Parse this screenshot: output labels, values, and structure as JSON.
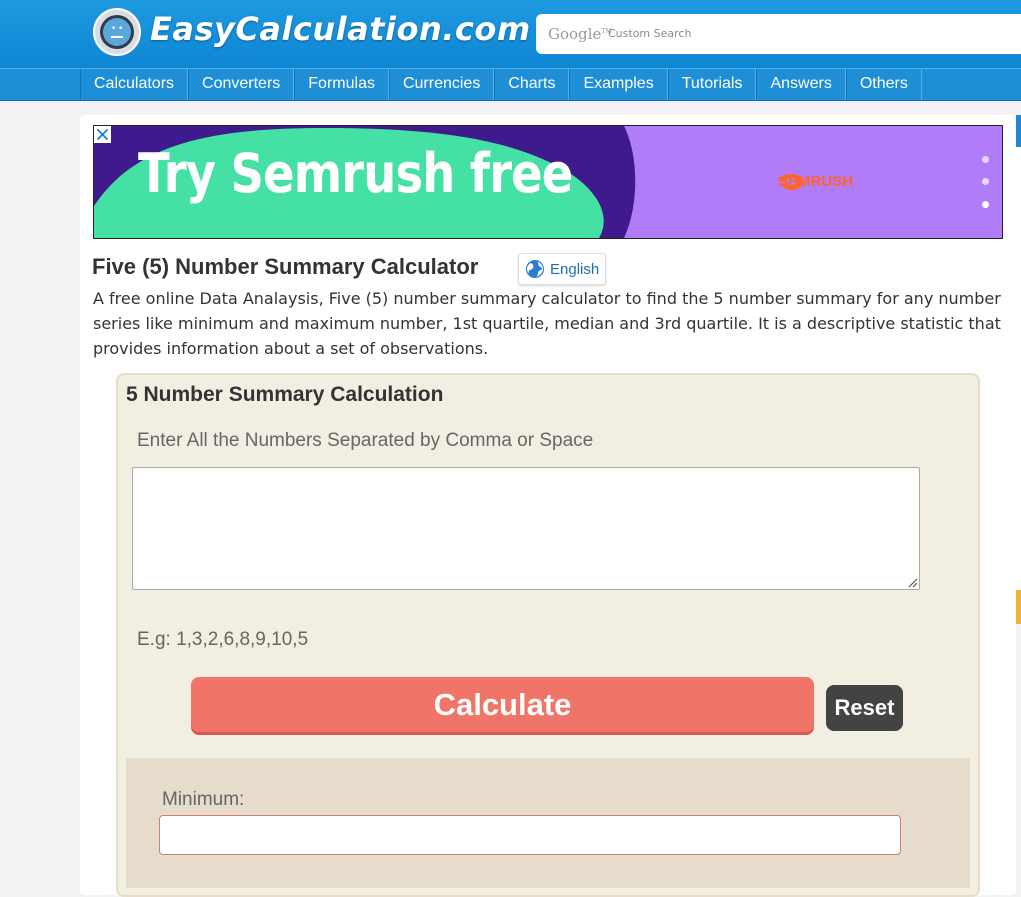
{
  "site": {
    "logo_text": "EasyCalculation.com",
    "search_brand": "Google",
    "search_brand_tm": "TM",
    "search_placeholder": "Custom Search"
  },
  "nav": {
    "items": [
      "Calculators",
      "Converters",
      "Formulas",
      "Currencies",
      "Charts",
      "Examples",
      "Tutorials",
      "Answers",
      "Others"
    ]
  },
  "ad": {
    "headline": "Try Semrush free",
    "brand": "SEMRUSH",
    "info_icon": "info-icon",
    "close_icon": "close-icon",
    "colors": {
      "purple": "#3f1a8c",
      "green": "#44e0a4",
      "lavender": "#b07cf7",
      "brand": "#ff642d"
    }
  },
  "page": {
    "title": "Five (5) Number Summary Calculator",
    "language": "English",
    "intro": "A free online Data Analaysis, Five (5) number summary calculator to find the 5 number summary for any number series like minimum and maximum number, 1st quartile, median and 3rd quartile. It is a descriptive statistic that provides information about a set of observations."
  },
  "calculator": {
    "title": "5 Number Summary Calculation",
    "input_label": "Enter All the Numbers Separated by Comma or Space",
    "input_value": "",
    "example": "E.g: 1,3,2,6,8,9,10,5",
    "calculate_label": "Calculate",
    "reset_label": "Reset",
    "results": {
      "minimum_label": "Minimum:",
      "minimum_value": ""
    },
    "colors": {
      "calculate": "#f07468",
      "reset": "#434343",
      "panel": "#f3eee2"
    }
  }
}
